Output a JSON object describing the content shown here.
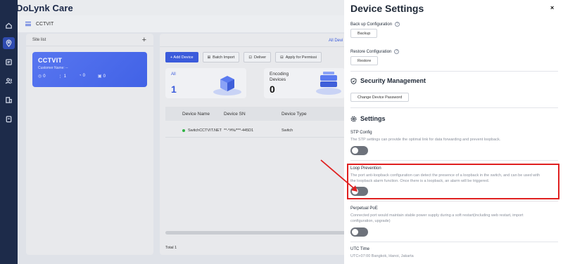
{
  "app": {
    "brand": "DoLynk Care",
    "brand_color": "#1a2747",
    "accent": "#3b5bdb"
  },
  "nav_rail": {
    "icons": [
      "home-icon",
      "location-pin-icon",
      "list-icon",
      "users-icon",
      "building-icon",
      "clipboard-icon"
    ],
    "active_index": 1
  },
  "breadcrumb": {
    "current": "CCTVIT"
  },
  "site_list": {
    "title": "Site list",
    "add_label": "+",
    "card": {
      "name": "CCTVIT",
      "subtitle": "Customer Name:  --",
      "stats": [
        {
          "icon": "camera-icon",
          "value": "0"
        },
        {
          "icon": "switch-icon",
          "value": "1"
        },
        {
          "icon": "alarm-icon",
          "value": "0"
        },
        {
          "icon": "recorder-icon",
          "value": "0"
        }
      ]
    }
  },
  "main": {
    "tab_all": "All Devi",
    "toolbar": {
      "add_device": "+ Add Device",
      "batch_import": "Batch Import",
      "deliver": "Deliver",
      "apply_permission": "Apply for Permissi"
    },
    "stats": [
      {
        "label": "All",
        "value": "1"
      },
      {
        "label_line1": "Encoding",
        "label_line2": "Devices",
        "value": "0"
      }
    ],
    "table": {
      "columns": [
        "Device Name",
        "Device SN",
        "Device Type"
      ],
      "rows": [
        {
          "name": "SwitchCCTVIT.NET",
          "sn": "**-*#%/***-445D1",
          "type": "Switch",
          "status": "online"
        }
      ]
    },
    "total_label": "Total 1"
  },
  "drawer": {
    "title": "Device Settings",
    "close": "×",
    "backup": {
      "label": "Back up Configuration",
      "button": "Backup"
    },
    "restore": {
      "label": "Restore Configuration",
      "button": "Restore"
    },
    "security": {
      "title": "Security Management",
      "button": "Change Device Password"
    },
    "settings": {
      "title": "Settings",
      "stp": {
        "title": "STP Config",
        "desc": "The STP settings can provide the optimal link for data forwarding and prevent loopback.",
        "enabled": false
      },
      "loop": {
        "title": "Loop Prevention",
        "desc": "The port anti-loopback configuration can detect the presence of a loopback in the switch, and can be used with the loopback alarm function. Once there is a loopback, an alarm will be triggered.",
        "enabled": false
      },
      "poe": {
        "title": "Perpetual PoE",
        "desc": "Connected port would maintain stable power supply during a soft restart(including web restart, import configuration, upgrade)",
        "enabled": false
      },
      "utc": {
        "title": "UTC Time",
        "value": "UTC+07:00 Bangkok, Hanoi, Jakarta"
      }
    }
  },
  "annotation": {
    "highlight_color": "#e02020"
  }
}
